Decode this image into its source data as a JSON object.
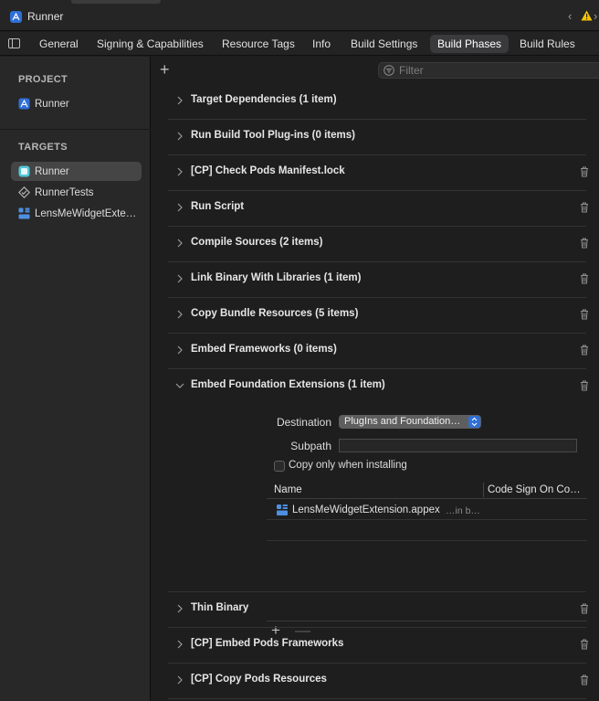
{
  "window": {
    "title": "Runner"
  },
  "tabs": [
    {
      "label": "General"
    },
    {
      "label": "Signing & Capabilities"
    },
    {
      "label": "Resource Tags"
    },
    {
      "label": "Info"
    },
    {
      "label": "Build Settings"
    },
    {
      "label": "Build Phases",
      "active": true
    },
    {
      "label": "Build Rules"
    }
  ],
  "sidebar": {
    "project_header": "PROJECT",
    "project_item": "Runner",
    "targets_header": "TARGETS",
    "targets": [
      {
        "label": "Runner",
        "icon": "app-target-icon",
        "selected": true
      },
      {
        "label": "RunnerTests",
        "icon": "test-target-icon"
      },
      {
        "label": "LensMeWidgetExtension",
        "icon": "extension-target-icon"
      }
    ]
  },
  "filter": {
    "placeholder": "Filter",
    "value": ""
  },
  "phases_before": [
    {
      "name": "Target Dependencies (1 item)",
      "deletable": false
    },
    {
      "name": "Run Build Tool Plug-ins (0 items)",
      "deletable": false
    },
    {
      "name": "[CP] Check Pods Manifest.lock",
      "deletable": true
    },
    {
      "name": "Run Script",
      "deletable": true
    },
    {
      "name": "Compile Sources (2 items)",
      "deletable": true
    },
    {
      "name": "Link Binary With Libraries (1 item)",
      "deletable": true
    },
    {
      "name": "Copy Bundle Resources (5 items)",
      "deletable": true
    },
    {
      "name": "Embed Frameworks (0 items)",
      "deletable": true
    }
  ],
  "expanded_phase": {
    "name": "Embed Foundation Extensions (1 item)",
    "destination_label": "Destination",
    "destination_value": "PlugIns and Foundation…",
    "subpath_label": "Subpath",
    "subpath_value": "",
    "copy_only_label": "Copy only when installing",
    "copy_only_checked": false,
    "columns": [
      "Name",
      "Code Sign On Co…"
    ],
    "files": [
      {
        "name": "LensMeWidgetExtension.appex",
        "location": "…in b…"
      }
    ]
  },
  "phases_after": [
    {
      "name": "Thin Binary"
    },
    {
      "name": "[CP] Embed Pods Frameworks"
    },
    {
      "name": "[CP] Copy Pods Resources"
    }
  ],
  "colors": {
    "accent": "#2f6fd6",
    "warning": "#f5c400",
    "background": "#1e1e1e",
    "sidebar": "#282828"
  }
}
